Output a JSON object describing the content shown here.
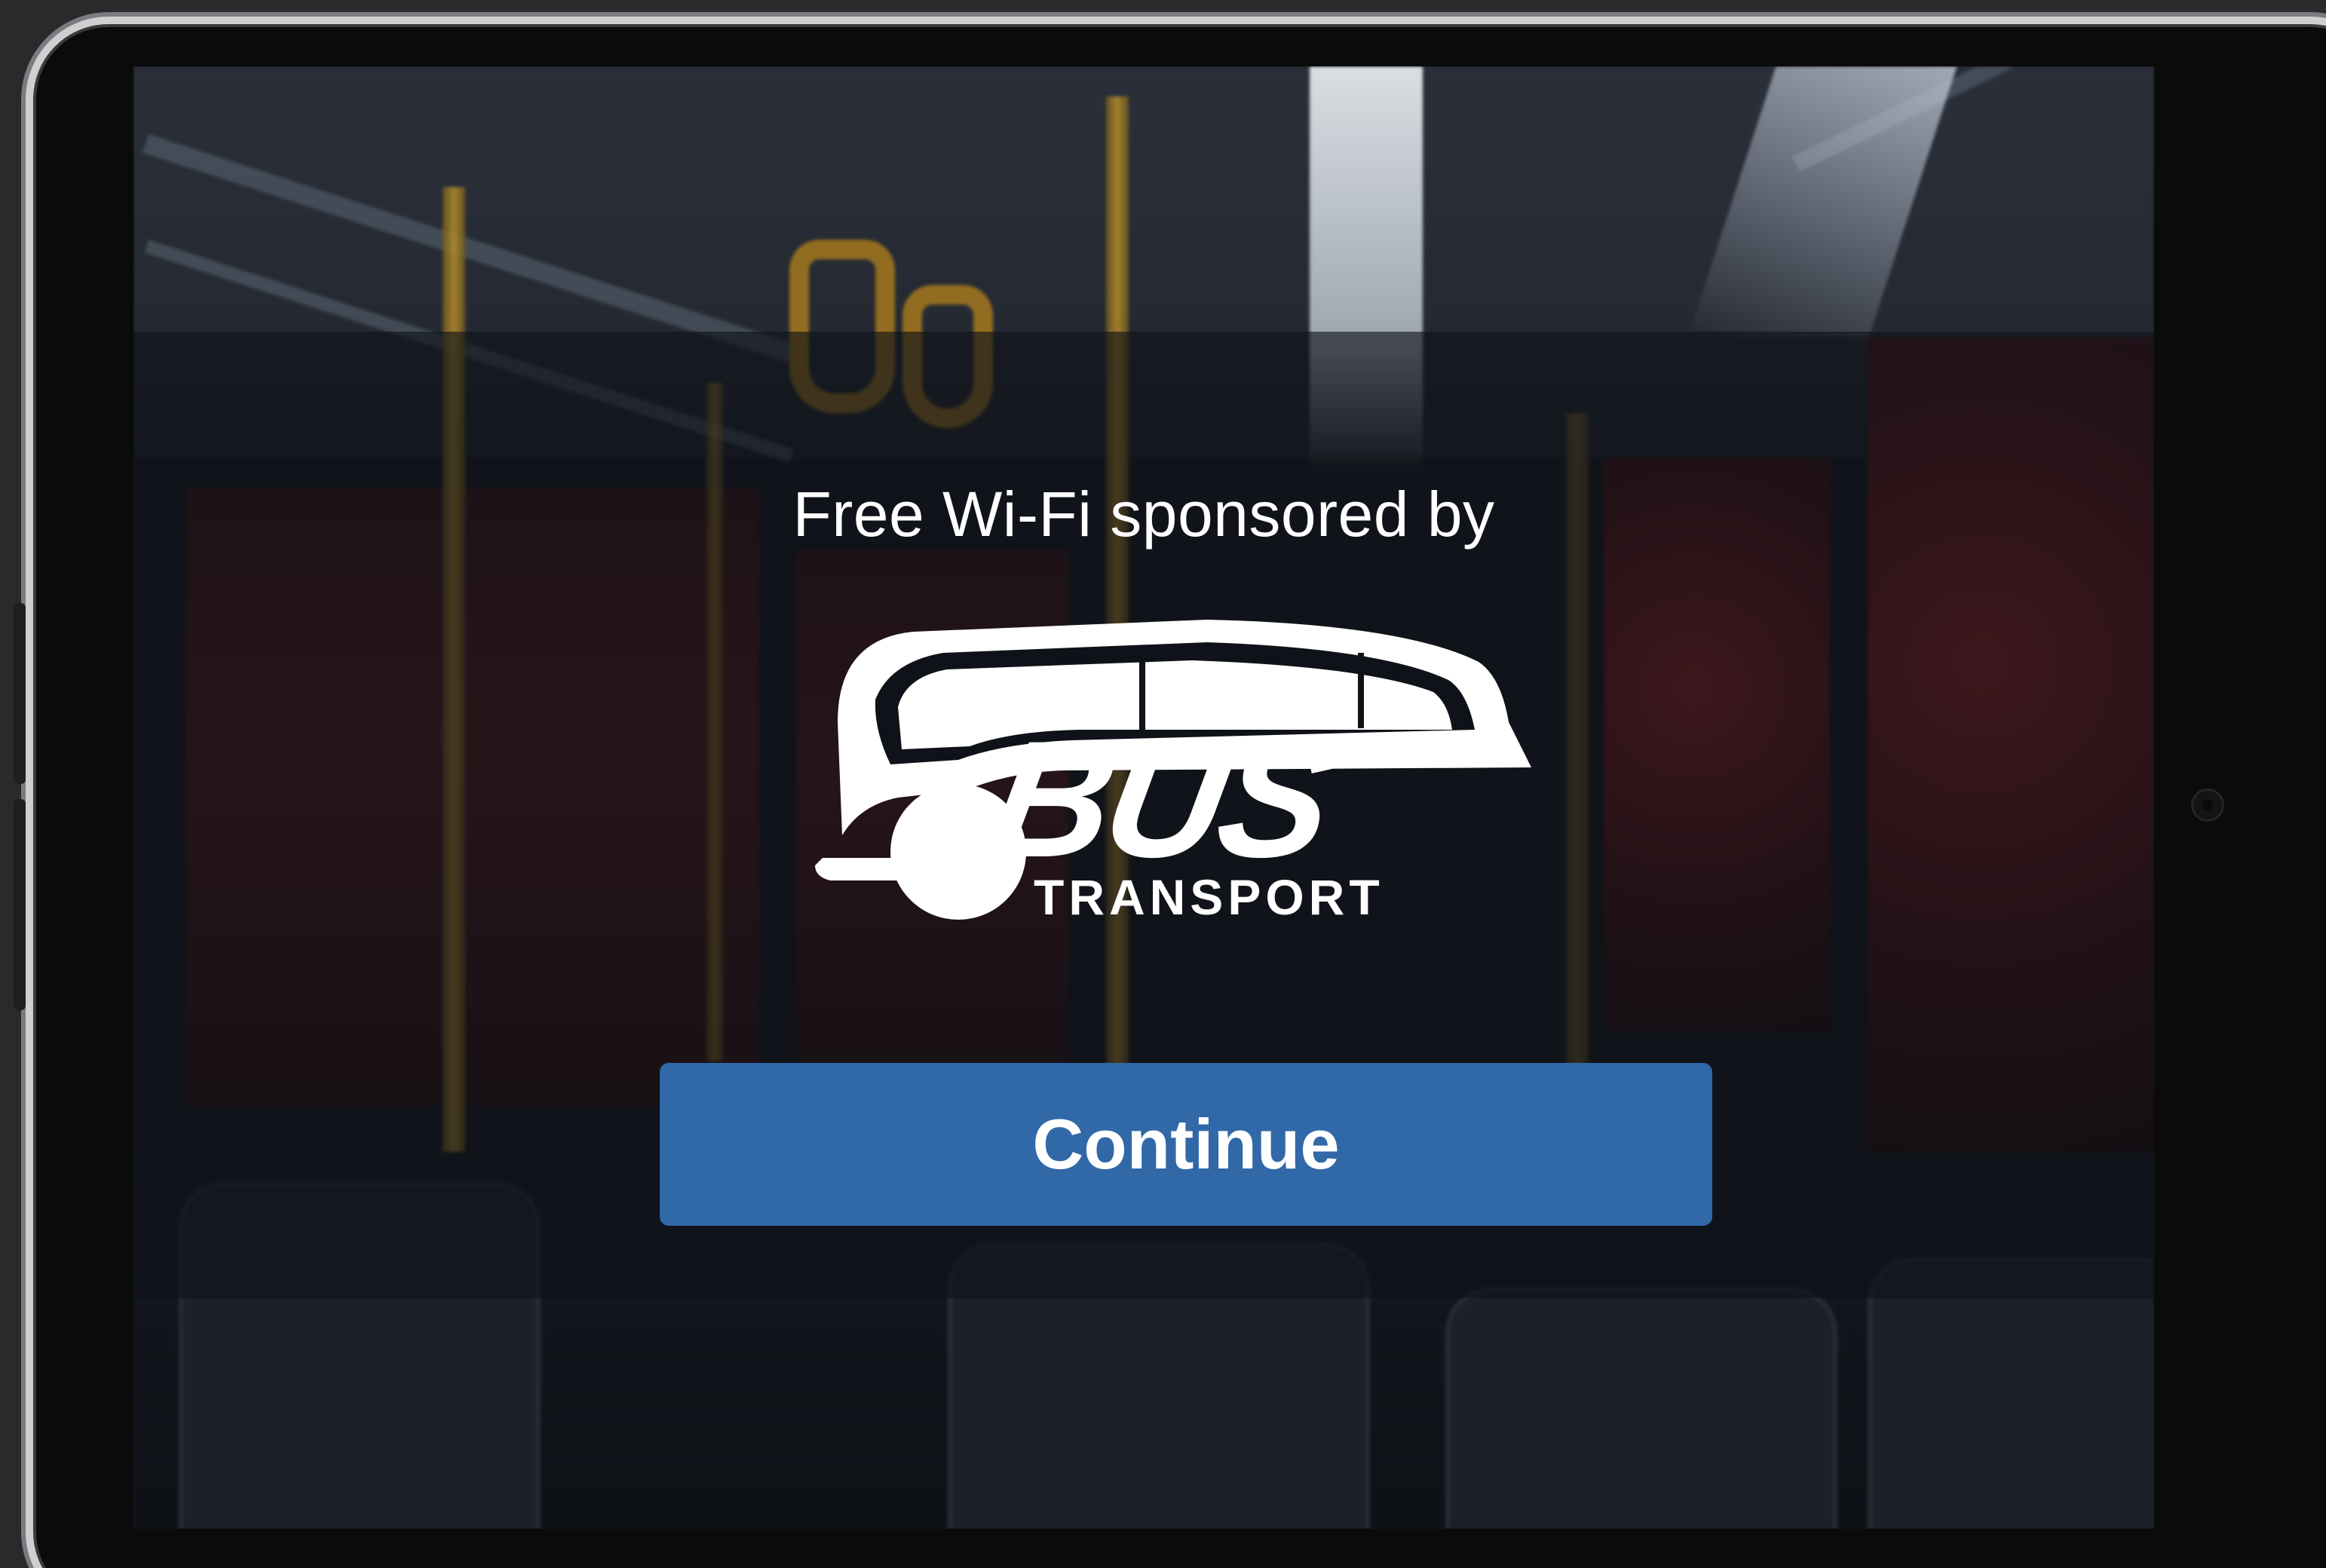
{
  "portal": {
    "sponsor_text": "Free Wi-Fi sponsored by",
    "logo": {
      "name": "bus-transport-logo",
      "word": "BUS",
      "subword": "TRANSPORT",
      "color": "#ffffff"
    },
    "continue_label": "Continue"
  },
  "colors": {
    "button_bg": "#3068a8",
    "text": "#ffffff",
    "overlay": "rgba(14,17,24,0.62)"
  },
  "icons": {
    "camera": "front-camera-icon"
  }
}
